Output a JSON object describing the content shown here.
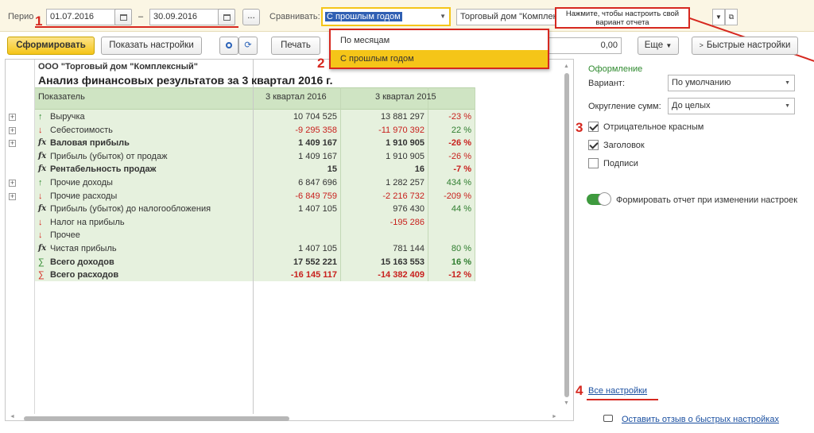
{
  "toolbar": {
    "period_label": "Перио",
    "date_from": "01.07.2016",
    "date_sep": "–",
    "date_to": "30.09.2016",
    "ellipsis": "...",
    "compare_label": "Сравнивать:",
    "compare_value": "С прошлым годом",
    "org_value": "Торговый дом \"Комплексный\"",
    "tooltip": "Нажмите, чтобы настроить свой вариант отчета"
  },
  "actions": {
    "generate": "Сформировать",
    "show_settings": "Показать настройки",
    "print": "Печать",
    "sum_value": "0,00",
    "more": "Еще",
    "quick_settings": "Быстрые настройки"
  },
  "dropdown": {
    "options": [
      "По месяцам",
      "С прошлым годом"
    ],
    "selected": 1
  },
  "markers": [
    "1",
    "2",
    "3",
    "4"
  ],
  "report": {
    "company": "ООО \"Торговый дом \"Комплексный\"",
    "title": "Анализ финансовых результатов за 3 квартал 2016 г.",
    "headers": [
      "Показатель",
      "3 квартал 2016",
      "3 квартал 2015"
    ],
    "rows": [
      {
        "label": "Выручка",
        "icon": "arrow-up",
        "expand": true,
        "bold": false,
        "v1": "10 704 525",
        "v2": "13 881 297",
        "pct": "-23 %"
      },
      {
        "label": "Себестоимость",
        "icon": "arrow-down",
        "expand": true,
        "bold": false,
        "v1": "-9 295 358",
        "v2": "-11 970 392",
        "pct": "22 %"
      },
      {
        "label": "Валовая прибыль",
        "icon": "fx",
        "expand": true,
        "bold": true,
        "v1": "1 409 167",
        "v2": "1 910 905",
        "pct": "-26 %"
      },
      {
        "label": "Прибыль (убыток) от продаж",
        "icon": "fx",
        "expand": false,
        "bold": false,
        "v1": "1 409 167",
        "v2": "1 910 905",
        "pct": "-26 %"
      },
      {
        "label": "Рентабельность продаж",
        "icon": "fx",
        "expand": false,
        "bold": true,
        "v1": "15",
        "v2": "16",
        "pct": "-7 %"
      },
      {
        "label": "Прочие доходы",
        "icon": "arrow-up",
        "expand": true,
        "bold": false,
        "v1": "6 847 696",
        "v2": "1 282 257",
        "pct": "434 %"
      },
      {
        "label": "Прочие расходы",
        "icon": "arrow-down",
        "expand": true,
        "bold": false,
        "v1": "-6 849 759",
        "v2": "-2 216 732",
        "pct": "-209 %"
      },
      {
        "label": "Прибыль (убыток) до налогообложения",
        "icon": "fx",
        "expand": false,
        "bold": false,
        "v1": "1 407 105",
        "v2": "976 430",
        "pct": "44 %"
      },
      {
        "label": "Налог на прибыль",
        "icon": "arrow-down",
        "expand": false,
        "bold": false,
        "v1": "",
        "v2": "-195 286",
        "pct": ""
      },
      {
        "label": "Прочее",
        "icon": "arrow-down",
        "expand": false,
        "bold": false,
        "v1": "",
        "v2": "",
        "pct": ""
      },
      {
        "label": "Чистая прибыль",
        "icon": "fx",
        "expand": false,
        "bold": false,
        "v1": "1 407 105",
        "v2": "781 144",
        "pct": "80 %"
      },
      {
        "label": "Всего доходов",
        "icon": "sigma",
        "expand": false,
        "bold": true,
        "v1": "17 552 221",
        "v2": "15 163 553",
        "pct": "16 %"
      },
      {
        "label": "Всего расходов",
        "icon": "sigma-red",
        "expand": false,
        "bold": true,
        "v1": "-16 145 117",
        "v2": "-14 382 409",
        "pct": "-12 %"
      }
    ]
  },
  "panel": {
    "section": "Оформление",
    "variant_label": "Вариант:",
    "variant_value": "По умолчанию",
    "rounding_label": "Округление сумм:",
    "rounding_value": "До целых",
    "checkboxes": [
      {
        "label": "Отрицательное красным",
        "checked": true
      },
      {
        "label": "Заголовок",
        "checked": true
      },
      {
        "label": "Подписи",
        "checked": false
      }
    ],
    "toggle_label": "Формировать отчет при изменении настроек",
    "toggle_on": true,
    "all_settings": "Все настройки",
    "feedback": "Оставить отзыв о быстрых настройках"
  },
  "colors": {
    "accent_yellow": "#f5c518",
    "header_green": "#cfe4c3",
    "row_green": "#e6f1de",
    "link": "#1a4fa0",
    "marker_red": "#d6281f",
    "toggle_green": "#3e9a3e"
  }
}
